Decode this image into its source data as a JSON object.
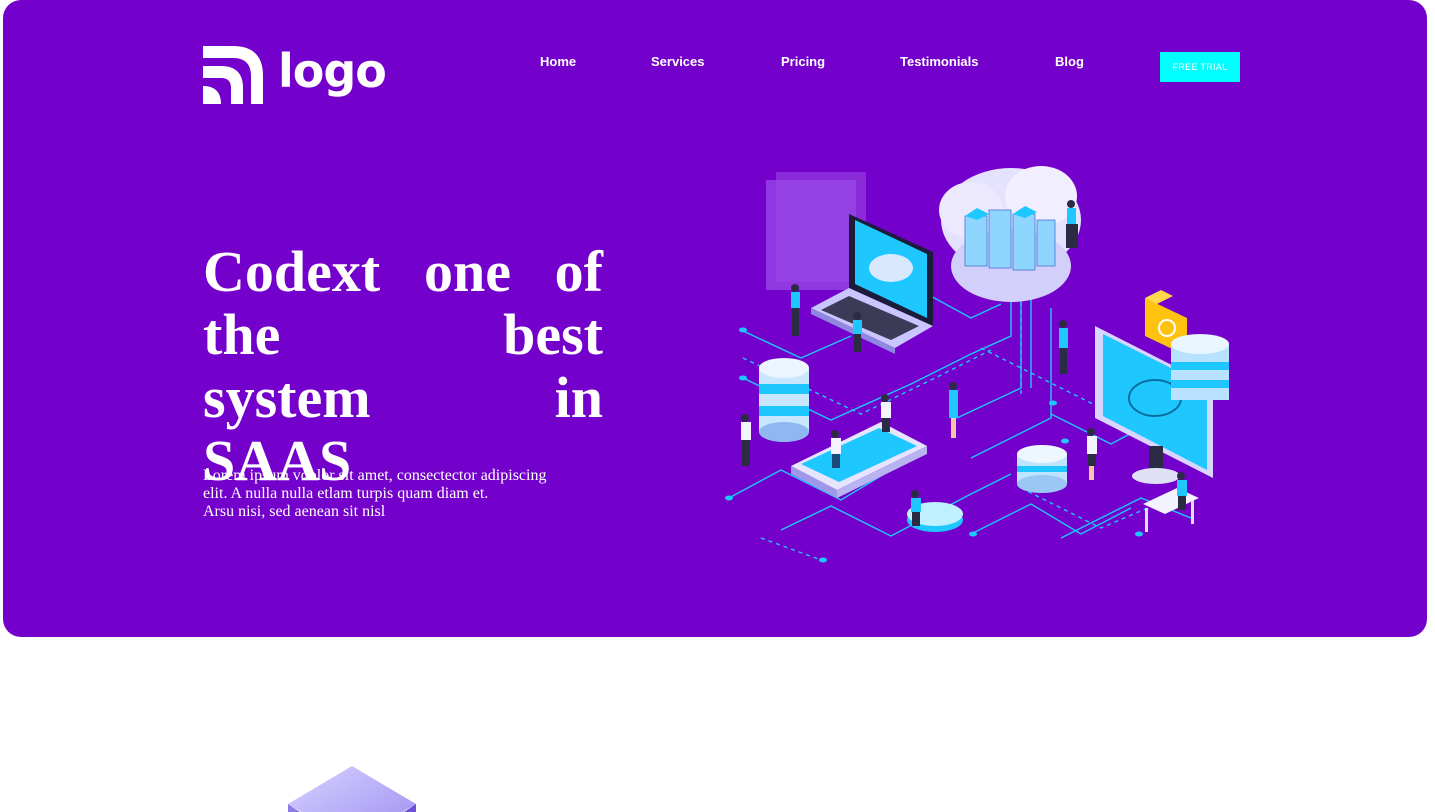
{
  "brand": {
    "logo_text": "logo"
  },
  "nav": {
    "items": [
      "Home",
      "Services",
      "Pricing",
      "Testimonials",
      "Blog"
    ],
    "cta_label": "FREE TRIAL"
  },
  "hero": {
    "headline": "Codext one of the best system in SAAS",
    "subtext_lines": [
      "Lorem ipsum vdolor sit amet, consectector adipiscing",
      "elit. A nulla nulla etlam turpis quam diam et.",
      "Arsu nisi, sed aenean sit nisl"
    ]
  },
  "colors": {
    "hero_bg": "#7400cb",
    "cta_bg": "#00ffff",
    "accent_cyan": "#1ec8ff",
    "text": "#ffffff"
  }
}
